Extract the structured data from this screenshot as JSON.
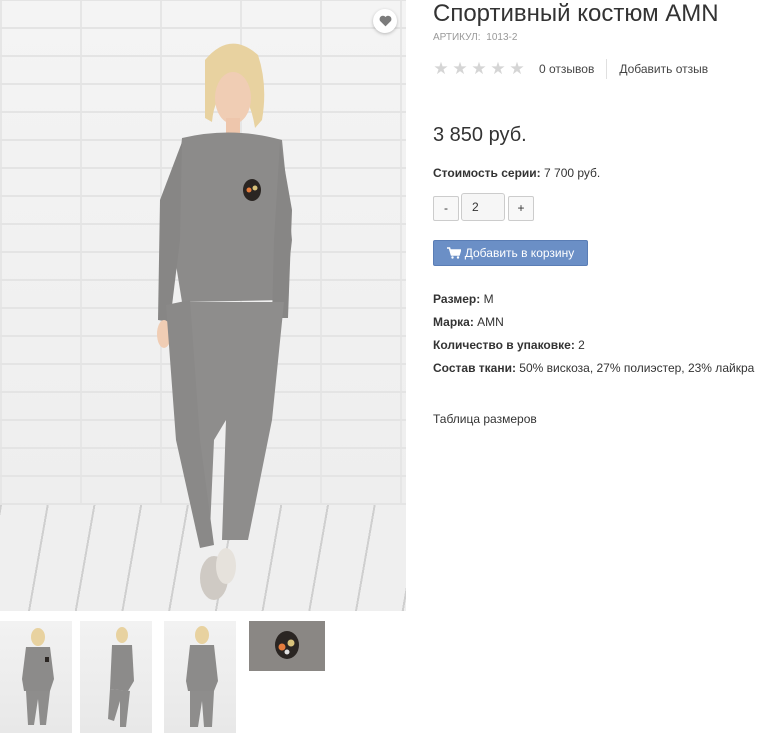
{
  "product": {
    "title": "Спортивный костюм AMN",
    "sku_label": "АРТИКУЛ:",
    "sku_value": "1013-2",
    "rating": {
      "stars_filled": 0,
      "stars_total": 5,
      "star_color": "#d5d5d5"
    },
    "reviews_count": "0 отзывов",
    "add_review": "Добавить отзыв",
    "price": "3 850 руб.",
    "series_label": "Стоимость серии:",
    "series_value": "7 700 руб.",
    "quantity": {
      "minus": "-",
      "value": "2",
      "plus": "+"
    },
    "add_to_cart": "Добавить в корзину",
    "add_to_cart_color": "#6b8fc6",
    "properties": [
      {
        "label": "Размер:",
        "value": "M"
      },
      {
        "label": "Марка:",
        "value": "AMN"
      },
      {
        "label": "Количество в упаковке:",
        "value": "2"
      },
      {
        "label": "Состав ткани:",
        "value": "50% вискоза, 27% полиэстер, 23% лайкра"
      }
    ],
    "size_table_link": "Таблица размеров"
  },
  "gallery": {
    "favorite_icon": "heart-icon",
    "thumbnails": [
      "front view",
      "side view",
      "back view",
      "patch detail"
    ]
  }
}
